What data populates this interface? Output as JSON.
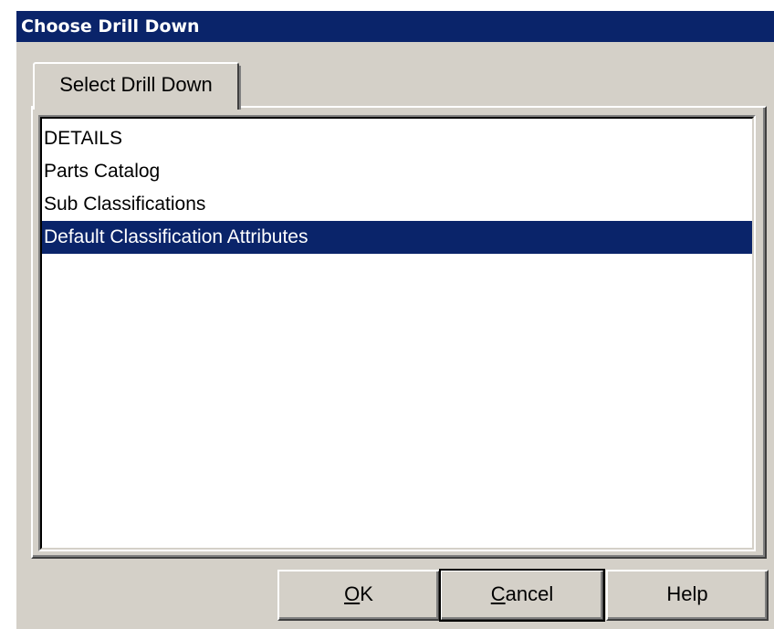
{
  "window": {
    "title": "Choose Drill Down"
  },
  "tabs": [
    {
      "label": "Select Drill Down",
      "active": true
    }
  ],
  "list": {
    "items": [
      {
        "label": "DETAILS",
        "selected": false
      },
      {
        "label": "Parts Catalog",
        "selected": false
      },
      {
        "label": "Sub Classifications",
        "selected": false
      },
      {
        "label": "Default Classification Attributes",
        "selected": true
      }
    ]
  },
  "buttons": {
    "ok": {
      "mnemonic": "O",
      "rest": "K"
    },
    "cancel": {
      "mnemonic": "C",
      "rest": "ancel"
    },
    "help": {
      "label": "Help"
    }
  },
  "colors": {
    "titlebar": "#0a246a",
    "selection": "#0a246a",
    "face": "#d4d0c8"
  }
}
